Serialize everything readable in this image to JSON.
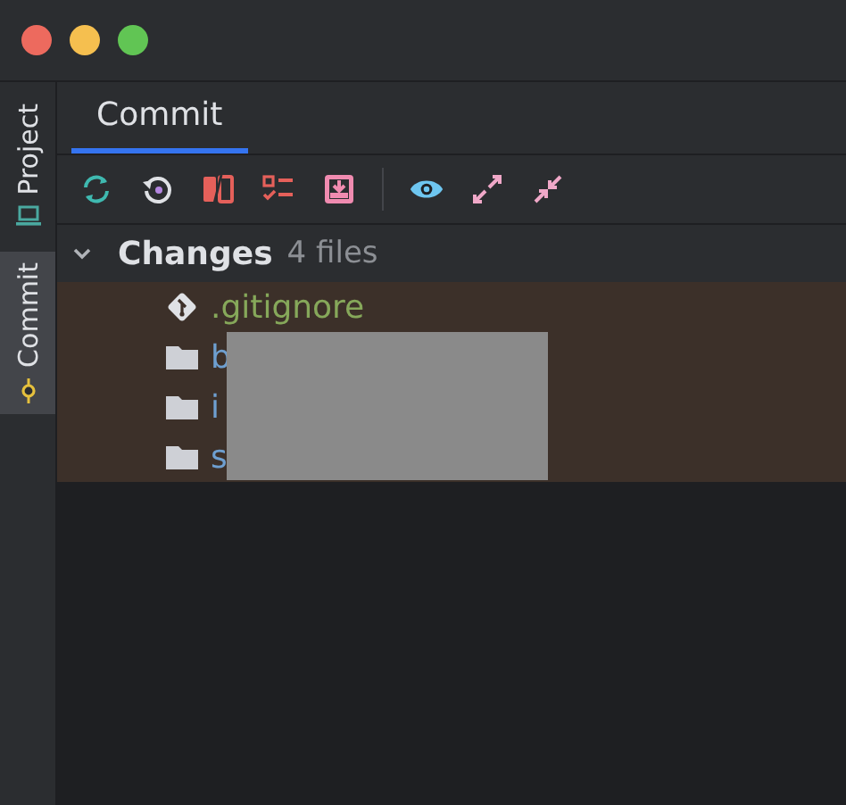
{
  "side_tabs": [
    {
      "label": "Project",
      "selected": false,
      "kind": "project"
    },
    {
      "label": "Commit",
      "selected": true,
      "kind": "commit"
    }
  ],
  "tabs": [
    {
      "label": "Commit",
      "selected": true
    }
  ],
  "toolbar": [
    {
      "kind": "refresh"
    },
    {
      "kind": "rollback"
    },
    {
      "kind": "diff"
    },
    {
      "kind": "checklist"
    },
    {
      "kind": "shelve"
    },
    {
      "kind": "separator"
    },
    {
      "kind": "eye"
    },
    {
      "kind": "expand"
    },
    {
      "kind": "collapse"
    }
  ],
  "changes": {
    "title": "Changes",
    "count": "4 files",
    "expanded": true,
    "files": [
      {
        "name": ".gitignore",
        "kind": "git"
      },
      {
        "name": "b",
        "kind": "folder"
      },
      {
        "name": "i",
        "kind": "folder"
      },
      {
        "name": "s",
        "kind": "folder"
      }
    ]
  }
}
